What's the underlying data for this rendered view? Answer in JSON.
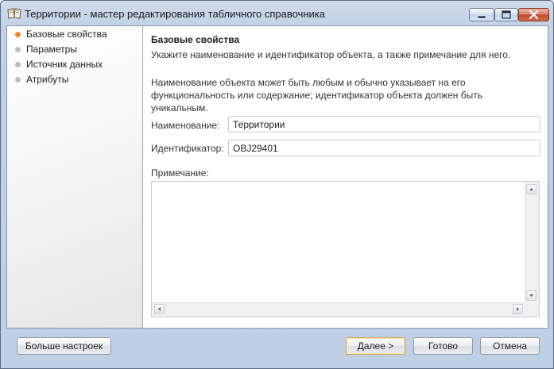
{
  "window": {
    "title": "Территории - мастер редактирования табличного справочника",
    "icon": "book-icon"
  },
  "sidebar": {
    "items": [
      {
        "label": "Базовые свойства",
        "active": true
      },
      {
        "label": "Параметры",
        "active": false
      },
      {
        "label": "Источник данных",
        "active": false
      },
      {
        "label": "Атрибуты",
        "active": false
      }
    ]
  },
  "page": {
    "title": "Базовые свойства",
    "subtitle": "Укажите наименование и идентификатор объекта, а также примечание для него.",
    "description": "Наименование объекта может быть любым и обычно указывает на его функциональность или содержание; идентификатор объекта должен быть уникальным."
  },
  "form": {
    "name_label": "Наименование:",
    "name_value": "Территории",
    "id_label": "Идентификатор:",
    "id_value": "OBJ29401",
    "note_label": "Примечание:",
    "note_value": ""
  },
  "buttons": {
    "more": "Больше настроек",
    "next": "Далее >",
    "finish": "Готово",
    "cancel": "Отмена"
  },
  "colors": {
    "active_dot": "#f08a24",
    "inactive_dot": "#bdbdbd",
    "close_button": "#c5452a"
  }
}
